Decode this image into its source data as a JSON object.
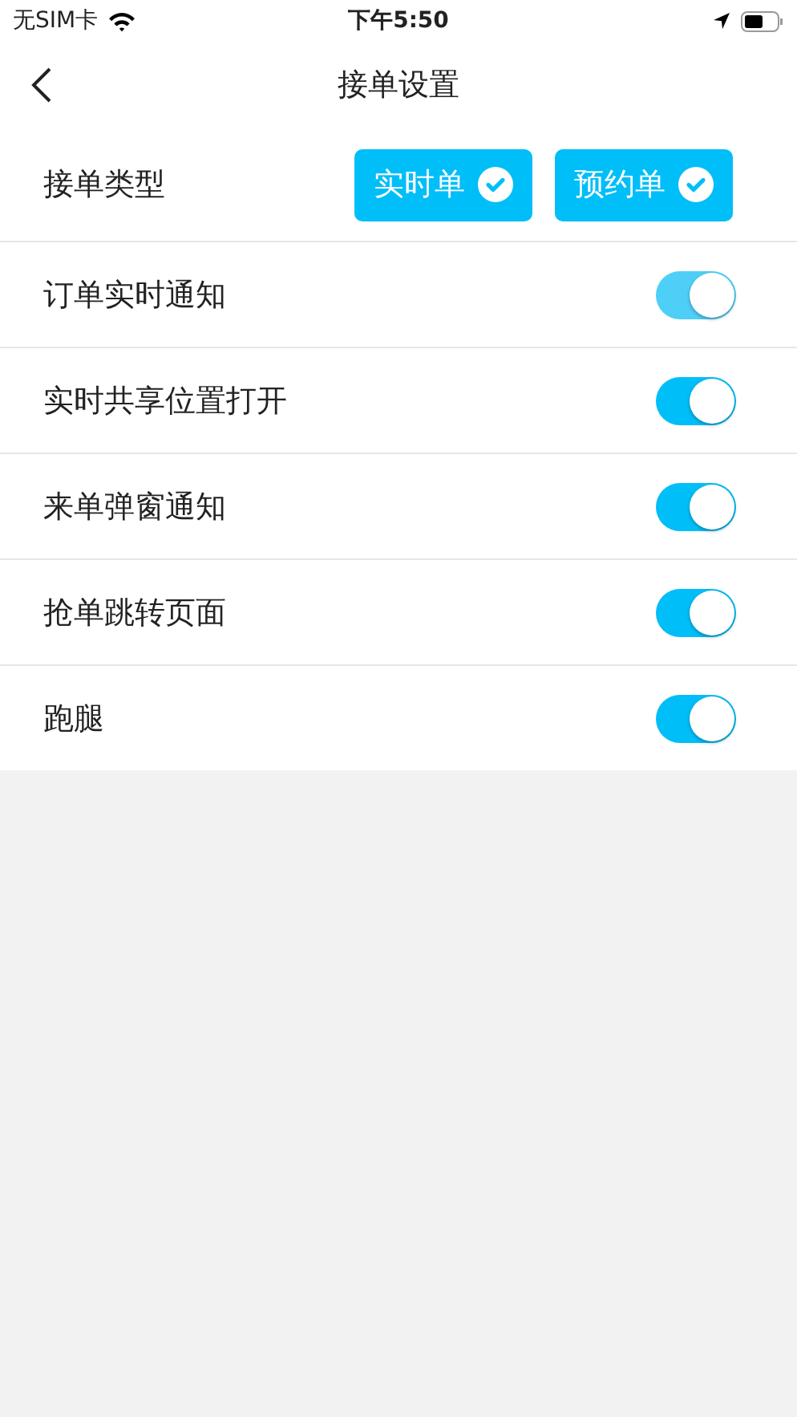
{
  "status_bar": {
    "carrier": "无SIM卡",
    "time": "下午5:50"
  },
  "nav": {
    "title": "接单设置"
  },
  "order_type": {
    "label": "接单类型",
    "options": [
      {
        "label": "实时单",
        "selected": true
      },
      {
        "label": "预约单",
        "selected": true
      }
    ]
  },
  "settings": [
    {
      "label": "订单实时通知",
      "on": true,
      "disabled": true
    },
    {
      "label": "实时共享位置打开",
      "on": true,
      "disabled": false
    },
    {
      "label": "来单弹窗通知",
      "on": true,
      "disabled": false
    },
    {
      "label": "抢单跳转页面",
      "on": true,
      "disabled": false
    },
    {
      "label": "跑腿",
      "on": true,
      "disabled": false
    }
  ]
}
